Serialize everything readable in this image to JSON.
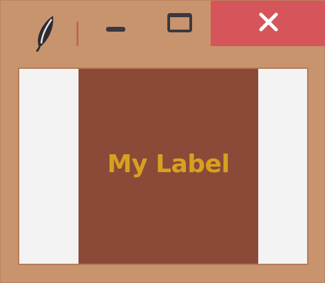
{
  "window": {
    "colors": {
      "frame": "#c8946e",
      "close_button": "#d6555a",
      "client_background": "#f3f3f3",
      "label_background": "#8b4a38",
      "label_foreground": "#d9a020"
    },
    "icons": {
      "app": "feather-icon",
      "minimize": "minimize-icon",
      "maximize": "maximize-icon",
      "close": "close-icon"
    }
  },
  "label": {
    "text": "My Label"
  }
}
